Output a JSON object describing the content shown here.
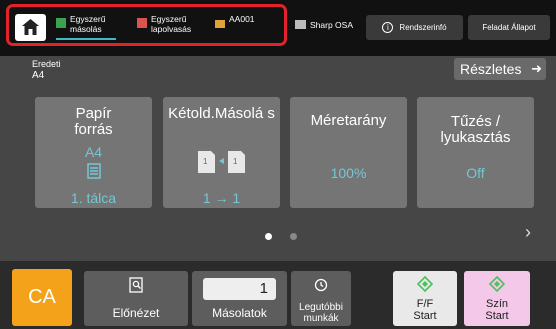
{
  "topbar": {
    "tabs": [
      {
        "label_line1": "Egyszerű",
        "label_line2": "másolás",
        "icon": "copy-icon",
        "active": true
      },
      {
        "label_line1": "Egyszerű",
        "label_line2": "lapolvasás",
        "icon": "scan-icon",
        "active": false
      },
      {
        "label_line1": "AA001",
        "label_line2": "",
        "icon": "folder-icon",
        "active": false
      }
    ],
    "sharp_label": "Sharp OSA",
    "sysinfo_label": "Rendszerinfó",
    "sysinfo_icon": "i",
    "jobstatus_label": "Feladat Állapot",
    "highlight_color": "#e2232a"
  },
  "info": {
    "original_label": "Eredeti",
    "original_value": "A4",
    "details_label": "Részletes",
    "details_arrow": "➜"
  },
  "tiles": [
    {
      "title": "Papír forrás",
      "sub": "A4",
      "icon": "tray-icon",
      "value": "1. tálca"
    },
    {
      "title": "Kétold.Másolá s",
      "sub": "",
      "icon": "duplex-icon",
      "value": "1 → 1"
    },
    {
      "title": "Méretarány",
      "sub": "",
      "icon": "",
      "value": "100%"
    },
    {
      "title": "Tűzés / lyukasztás",
      "sub": "",
      "icon": "",
      "value": "Off"
    }
  ],
  "pager": {
    "pages": 2,
    "current": 1,
    "next_glyph": "›"
  },
  "bottombar": {
    "ca_label": "CA",
    "preview_label": "Előnézet",
    "copies_value": "1",
    "copies_label": "Másolatok",
    "recent_label_line1": "Legutóbbi",
    "recent_label_line2": "munkák",
    "bw_start_line1": "F/F",
    "bw_start_line2": "Start",
    "color_start_line1": "Szín",
    "color_start_line2": "Start"
  },
  "colors": {
    "accent": "#74c6d6",
    "ca": "#f5a21b",
    "color_start_bg": "#f3c8e8",
    "bw_start_bg": "#e9e9e9",
    "start_diamond": "#4cc05b"
  }
}
